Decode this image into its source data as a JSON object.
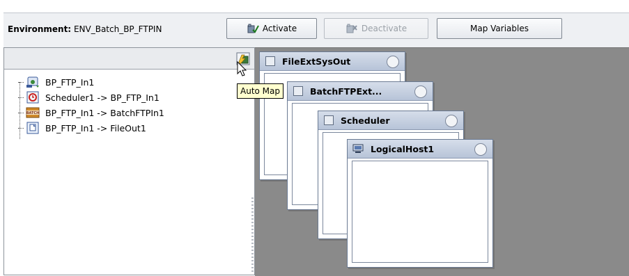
{
  "toolbar": {
    "environment_label": "Environment:",
    "environment_value": "ENV_Batch_BP_FTPIN",
    "activate_label": "Activate",
    "deactivate_label": "Deactivate",
    "map_variables_label": "Map Variables"
  },
  "left_panel": {
    "automap_icon": "auto-map-icon",
    "tree": [
      {
        "label": "BP_FTP_In1",
        "icon": "business-process-icon"
      },
      {
        "label": "Scheduler1 -> BP_FTP_In1",
        "icon": "scheduler-icon"
      },
      {
        "label": "BP_FTP_In1 -> BatchFTPIn1",
        "icon": "batch-icon",
        "icon_text": "BATCH"
      },
      {
        "label": "BP_FTP_In1 -> FileOut1",
        "icon": "file-icon"
      }
    ]
  },
  "tooltip": "Auto Map",
  "canvas": {
    "windows": [
      {
        "title": "FileExtSysOut"
      },
      {
        "title": "BatchFTPExt..."
      },
      {
        "title": "Scheduler"
      },
      {
        "title": "LogicalHost1"
      }
    ]
  },
  "colors": {
    "canvas_bg": "#8a8a8a",
    "titlebar": "#c5d0e1",
    "tooltip_bg": "#ffffcf"
  }
}
